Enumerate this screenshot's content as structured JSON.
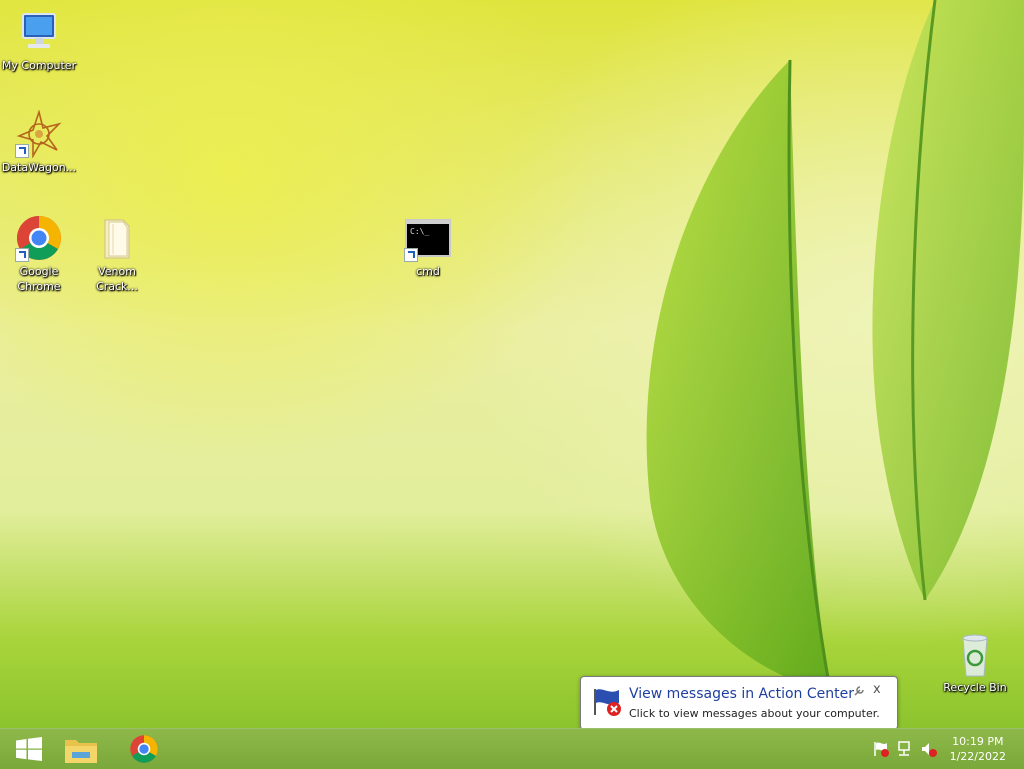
{
  "desktop": {
    "icons": [
      {
        "label": "My Computer",
        "icon": "computer-icon"
      },
      {
        "label": "DataWagon...",
        "icon": "datawagon-icon",
        "shortcut": true
      },
      {
        "label": "Google\nChrome",
        "icon": "chrome-icon",
        "shortcut": true
      },
      {
        "label": "Venom\nCrack...",
        "icon": "folder-icon"
      },
      {
        "label": "cmd",
        "icon": "cmd-icon",
        "shortcut": true
      },
      {
        "label": "Recycle Bin",
        "icon": "recycle-bin-icon"
      }
    ]
  },
  "taskbar": {
    "start_icon": "windows-logo-icon",
    "pinned": [
      {
        "name": "File Explorer",
        "icon": "file-explorer-icon"
      },
      {
        "name": "Google Chrome",
        "icon": "chrome-icon"
      }
    ],
    "tray": {
      "icons": [
        "action-center-flag-icon",
        "network-icon",
        "volume-muted-icon"
      ]
    },
    "clock": {
      "time": "10:19 PM",
      "date": "1/22/2022"
    }
  },
  "notification": {
    "title": "View messages in Action Center",
    "text": "Click to view messages about your computer.",
    "icon": "action-center-flag-icon",
    "close": "x"
  },
  "colors": {
    "taskbar": "#7aa83a",
    "balloon_title": "#1e3fa0"
  }
}
